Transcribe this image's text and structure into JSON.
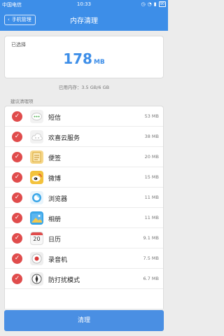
{
  "status_bar": {
    "carrier": "中国电信",
    "time": "10:33",
    "battery": "90"
  },
  "header": {
    "back_label": "手机管理",
    "title": "内存清理"
  },
  "summary": {
    "selected_label": "已选择",
    "size_value": "178",
    "size_unit": "MB"
  },
  "used_memory": "已用内存：3.5 GB/6 GB",
  "suggest_label": "建议清理项",
  "apps": [
    {
      "name": "短信",
      "size": "53 MB",
      "icon": "message-icon",
      "color": "#f2f2f2"
    },
    {
      "name": "欢喜云服务",
      "size": "38 MB",
      "icon": "cloud-icon",
      "color": "#f2f2f2"
    },
    {
      "name": "便签",
      "size": "20 MB",
      "icon": "notes-icon",
      "color": "#f6d78a"
    },
    {
      "name": "微博",
      "size": "15 MB",
      "icon": "weibo-icon",
      "color": "#f3c23c"
    },
    {
      "name": "浏览器",
      "size": "11 MB",
      "icon": "browser-icon",
      "color": "#e9f4fb"
    },
    {
      "name": "相册",
      "size": "11 MB",
      "icon": "gallery-icon",
      "color": "#3aa6e8"
    },
    {
      "name": "日历",
      "size": "9.1 MB",
      "icon": "calendar-icon",
      "color": "#f7f7f7"
    },
    {
      "name": "录音机",
      "size": "7.5 MB",
      "icon": "recorder-icon",
      "color": "#eeeeee"
    },
    {
      "name": "防打扰模式",
      "size": "6.7 MB",
      "icon": "dnd-icon",
      "color": "#eeeeee"
    }
  ],
  "calendar_day": "20",
  "clean_button": "清理",
  "colors": {
    "accent": "#3d8ee8",
    "check": "#e04c4c"
  }
}
